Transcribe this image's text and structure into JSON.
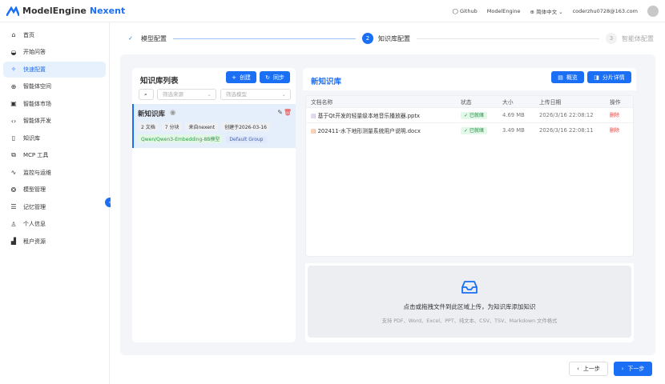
{
  "header": {
    "logo_a": "ModelEngine",
    "logo_b": "Nexent",
    "links": [
      "Github",
      "ModelEngine"
    ],
    "language": "简体中文",
    "user": "coderzhu0728@163.com"
  },
  "sidebar": {
    "items": [
      {
        "label": "首页",
        "icon": "home-icon",
        "glyph": "⌂"
      },
      {
        "label": "开始问答",
        "icon": "chat-robot-icon",
        "glyph": "◒"
      },
      {
        "label": "快速配置",
        "icon": "sparkle-icon",
        "glyph": "✧",
        "active": true
      },
      {
        "label": "智能体空间",
        "icon": "globe-icon",
        "glyph": "⊕"
      },
      {
        "label": "智能体市场",
        "icon": "store-icon",
        "glyph": "▣"
      },
      {
        "label": "智能体开发",
        "icon": "code-icon",
        "glyph": "‹›"
      },
      {
        "label": "知识库",
        "icon": "book-icon",
        "glyph": "▯"
      },
      {
        "label": "MCP 工具",
        "icon": "puzzle-icon",
        "glyph": "⧉"
      },
      {
        "label": "监控与运维",
        "icon": "activity-icon",
        "glyph": "∿"
      },
      {
        "label": "模型管理",
        "icon": "model-icon",
        "glyph": "❂"
      },
      {
        "label": "记忆管理",
        "icon": "database-icon",
        "glyph": "☰"
      },
      {
        "label": "个人信息",
        "icon": "user-icon",
        "glyph": "♙"
      },
      {
        "label": "租户资源",
        "icon": "building-icon",
        "glyph": "▟"
      }
    ]
  },
  "steps": [
    {
      "num": "✓",
      "label": "模型配置",
      "state": "done"
    },
    {
      "num": "2",
      "label": "知识库配置",
      "state": "active"
    },
    {
      "num": "3",
      "label": "智能体配置",
      "state": "pending"
    }
  ],
  "kb_list": {
    "title": "知识库列表",
    "create": "创建",
    "sync": "同步",
    "filter_source": "筛选来源",
    "filter_model": "筛选模型",
    "items": [
      {
        "name": "新知识库",
        "tags": [
          "2 文档",
          "7 分块",
          "来自nexent",
          "创建于2026-03-16"
        ],
        "model": "Qwen/Qwen3-Embedding-8B模型",
        "group": "Default Group"
      }
    ]
  },
  "kb_detail": {
    "title": "新知识库",
    "overview": "概览",
    "chunks": "分片详情",
    "columns": [
      "文档名称",
      "状态",
      "大小",
      "上传日期",
      "操作"
    ],
    "rows": [
      {
        "name": "基于Qt开发的轻量级本地音乐播放器.pptx",
        "status": "✓ 已就绪",
        "size": "4.69 MB",
        "date": "2026/3/16 22:08:12",
        "action": "删除"
      },
      {
        "name": "202411-水下地形测量系统用户说明.docx",
        "status": "✓ 已就绪",
        "size": "3.49 MB",
        "date": "2026/3/16 22:08:11",
        "action": "删除"
      }
    ],
    "upload_main": "点击或拖拽文件到此区域上传，为知识库添加知识",
    "upload_sub": "支持 PDF、Word、Excel、PPT、纯文本、CSV、TSV、Markdown 文件格式"
  },
  "footer": {
    "prev": "上一步",
    "next": "下一步"
  },
  "colors": {
    "accent": "#1a6ff5",
    "danger": "#e53935",
    "success": "#1c8a3f"
  }
}
